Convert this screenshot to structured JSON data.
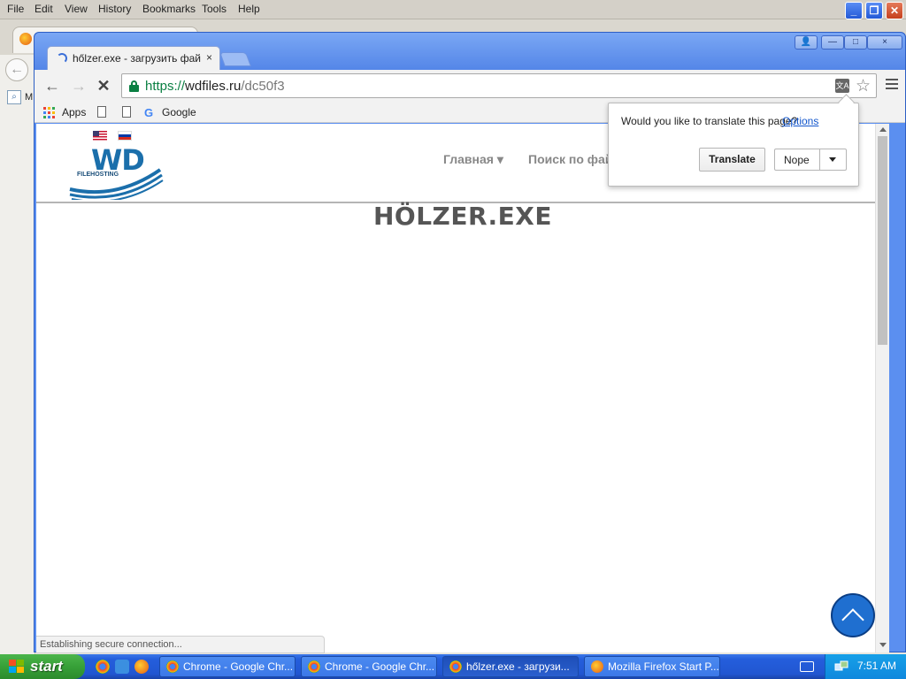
{
  "firefox": {
    "menu": [
      "File",
      "Edit",
      "View",
      "History",
      "Bookmarks",
      "Tools",
      "Help"
    ],
    "bookmark_partial": "M"
  },
  "chrome": {
    "tab_title": "hőlzer.exe - загрузить файл",
    "tab_close": "×",
    "url": {
      "scheme": "https://",
      "host": "wdfiles.ru",
      "path": "/dc50f3"
    },
    "bookmarks": {
      "apps": "Apps",
      "google": "Google"
    },
    "window_controls": {
      "user": "👤",
      "minimize": "—",
      "maximize": "□",
      "close": "×"
    }
  },
  "page": {
    "logo_text": "WD",
    "logo_subtext": "FILEHOSTING",
    "nav": [
      "Главная ▾",
      "Поиск по фай"
    ],
    "title": "HÖLZER.EXE",
    "status": "Establishing secure connection..."
  },
  "translate": {
    "question": "Would you like to translate this page?",
    "options_link": "Options",
    "translate_button": "Translate",
    "nope_button": "Nope"
  },
  "taskbar": {
    "start": "start",
    "tasks": [
      {
        "label": "Chrome - Google Chr...",
        "icon": "chrome-icon"
      },
      {
        "label": "Chrome - Google Chr...",
        "icon": "chrome-icon"
      },
      {
        "label": "hőlzer.exe - загрузи...",
        "icon": "chrome-icon"
      },
      {
        "label": "Mozilla Firefox Start P...",
        "icon": "firefox-icon"
      }
    ],
    "clock": "7:51 AM"
  }
}
